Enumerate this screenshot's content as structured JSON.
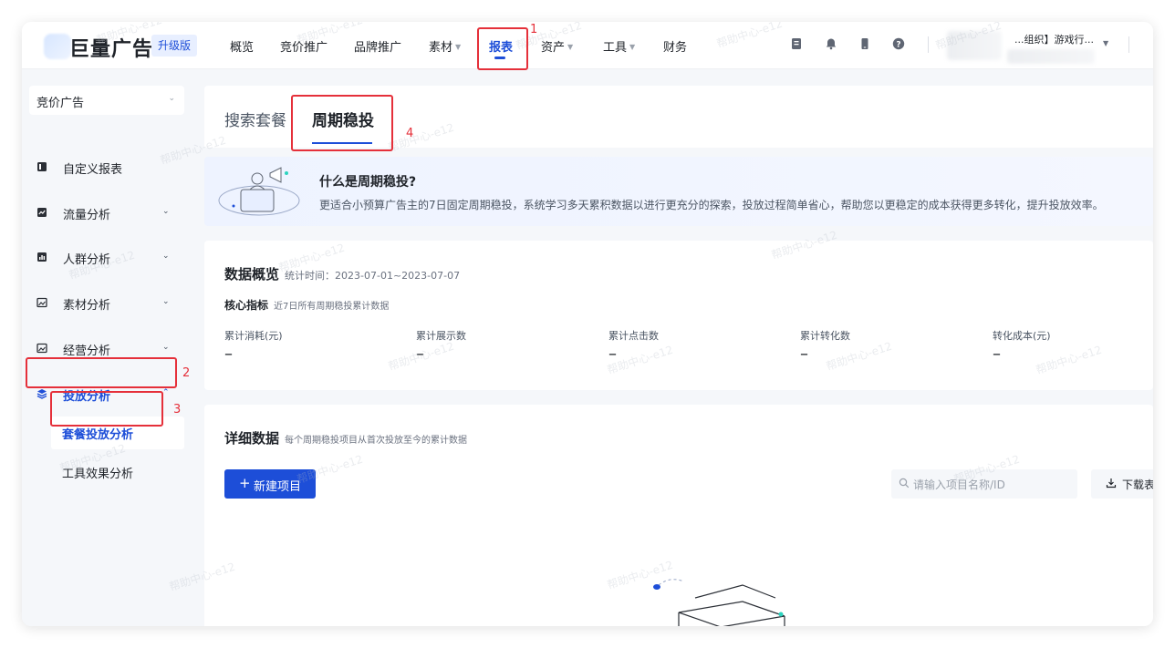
{
  "header": {
    "brand": "巨量广告",
    "edition": "升级版",
    "nav": [
      {
        "label": "概览",
        "caret": false
      },
      {
        "label": "竞价推广",
        "caret": false
      },
      {
        "label": "品牌推广",
        "caret": false
      },
      {
        "label": "素材",
        "caret": true
      },
      {
        "label": "报表",
        "caret": false,
        "active": true
      },
      {
        "label": "资产",
        "caret": true
      },
      {
        "label": "工具",
        "caret": true
      },
      {
        "label": "财务",
        "caret": false
      }
    ],
    "caret_glyph": "▼",
    "account": "...组织】游戏行..."
  },
  "sidebar": {
    "selector": "竞价广告",
    "items": [
      {
        "label": "自定义报表",
        "icon": "report-icon"
      },
      {
        "label": "流量分析",
        "icon": "trend-chart-icon"
      },
      {
        "label": "人群分析",
        "icon": "audience-chart-icon"
      },
      {
        "label": "素材分析",
        "icon": "image-icon"
      },
      {
        "label": "经营分析",
        "icon": "image-icon"
      },
      {
        "label": "投放分析",
        "icon": "layers-icon",
        "active": true
      }
    ],
    "sub_items": [
      {
        "label": "套餐投放分析",
        "active": true
      },
      {
        "label": "工具效果分析"
      }
    ],
    "chev_down": "⌄",
    "chev_up": "⌃"
  },
  "tabs": [
    {
      "label": "搜索套餐"
    },
    {
      "label": "周期稳投",
      "active": true
    }
  ],
  "banner": {
    "title": "什么是周期稳投?",
    "desc": "更适合小预算广告主的7日固定周期稳投，系统学习多天累积数据以进行更充分的探索，投放过程简单省心，帮助您以更稳定的成本获得更多转化，提升投放效率。"
  },
  "overview": {
    "title": "数据概览",
    "time_label": "统计时间：2023-07-01~2023-07-07",
    "core_title": "核心指标",
    "core_sub": "近7日所有周期稳投累计数据",
    "metrics": [
      {
        "label": "累计消耗(元)",
        "value": "–"
      },
      {
        "label": "累计展示数",
        "value": "–"
      },
      {
        "label": "累计点击数",
        "value": "–"
      },
      {
        "label": "累计转化数",
        "value": "–"
      },
      {
        "label": "转化成本(元)",
        "value": "–"
      }
    ]
  },
  "detail": {
    "title": "详细数据",
    "sub": "每个周期稳投项目从首次投放至今的累计数据",
    "new_button": "新建项目",
    "search_placeholder": "请输入项目名称/ID",
    "download": "下载表"
  },
  "annotations": [
    "1",
    "2",
    "3",
    "4"
  ],
  "watermark": "帮助中心-e12"
}
